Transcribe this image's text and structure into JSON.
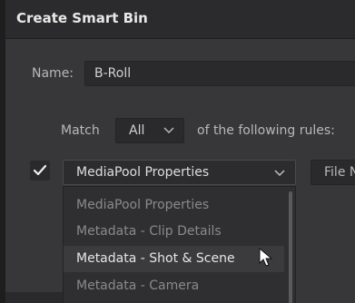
{
  "dialog": {
    "title": "Create Smart Bin"
  },
  "name_field": {
    "label": "Name:",
    "value": "B-Roll"
  },
  "match_row": {
    "label": "Match",
    "selected": "All",
    "suffix": "of the following rules:"
  },
  "rule": {
    "checked": true,
    "check_glyph": "✓",
    "field_selected": "MediaPool Properties",
    "operator_value": "File N"
  },
  "dropdown": {
    "items": [
      "MediaPool Properties",
      "Metadata - Clip Details",
      "Metadata - Shot & Scene",
      "Metadata - Camera"
    ],
    "highlighted_index": 2
  },
  "colors": {
    "dialog_bg": "#373739",
    "titlebar_bg": "#2b2b2d",
    "highlight_bg": "#3b3b3d"
  }
}
